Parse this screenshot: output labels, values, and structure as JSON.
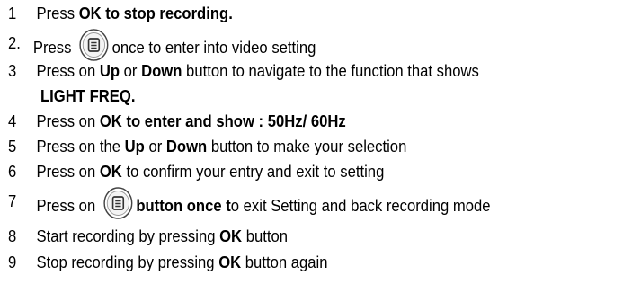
{
  "steps": [
    {
      "num": "1",
      "parts": [
        {
          "t": "Press ",
          "b": false
        },
        {
          "t": "OK to stop recording.",
          "b": true
        }
      ]
    },
    {
      "num": "2.",
      "parts": [
        {
          "t": "Press ",
          "b": false
        },
        {
          "icon": "menu-button-icon"
        },
        {
          "t": "once to enter into video setting",
          "b": false
        }
      ]
    },
    {
      "num": "3",
      "parts": [
        {
          "t": "Press on ",
          "b": false
        },
        {
          "t": "Up",
          "b": true
        },
        {
          "t": " or ",
          "b": false
        },
        {
          "t": "Down",
          "b": true
        },
        {
          "t": " button to navigate to the function that shows",
          "b": false
        }
      ],
      "cont": "LIGHT FREQ."
    },
    {
      "num": "4",
      "parts": [
        {
          "t": "Press on ",
          "b": false
        },
        {
          "t": "OK to enter and show : 50Hz/ 60Hz",
          "b": true
        }
      ]
    },
    {
      "num": "5",
      "parts": [
        {
          "t": "Press on the ",
          "b": false
        },
        {
          "t": "Up",
          "b": true
        },
        {
          "t": " or ",
          "b": false
        },
        {
          "t": "Down",
          "b": true
        },
        {
          "t": " button to make your selection",
          "b": false
        }
      ]
    },
    {
      "num": "6",
      "parts": [
        {
          "t": "Press on ",
          "b": false
        },
        {
          "t": "OK",
          "b": true
        },
        {
          "t": " to confirm your entry and exit to setting",
          "b": false
        }
      ]
    },
    {
      "num": "7",
      "parts": [
        {
          "t": "Press on ",
          "b": false
        },
        {
          "icon": "menu-button-icon"
        },
        {
          "t": "button once t",
          "b": true
        },
        {
          "t": "o exit Setting and back recording mode",
          "b": false
        }
      ]
    },
    {
      "num": "8",
      "parts": [
        {
          "t": "Start recording by pressing ",
          "b": false
        },
        {
          "t": "OK",
          "b": true
        },
        {
          "t": " button",
          "b": false
        }
      ]
    },
    {
      "num": "9",
      "parts": [
        {
          "t": "Stop recording by pressing ",
          "b": false
        },
        {
          "t": "OK",
          "b": true
        },
        {
          "t": " button again",
          "b": false
        }
      ]
    }
  ]
}
